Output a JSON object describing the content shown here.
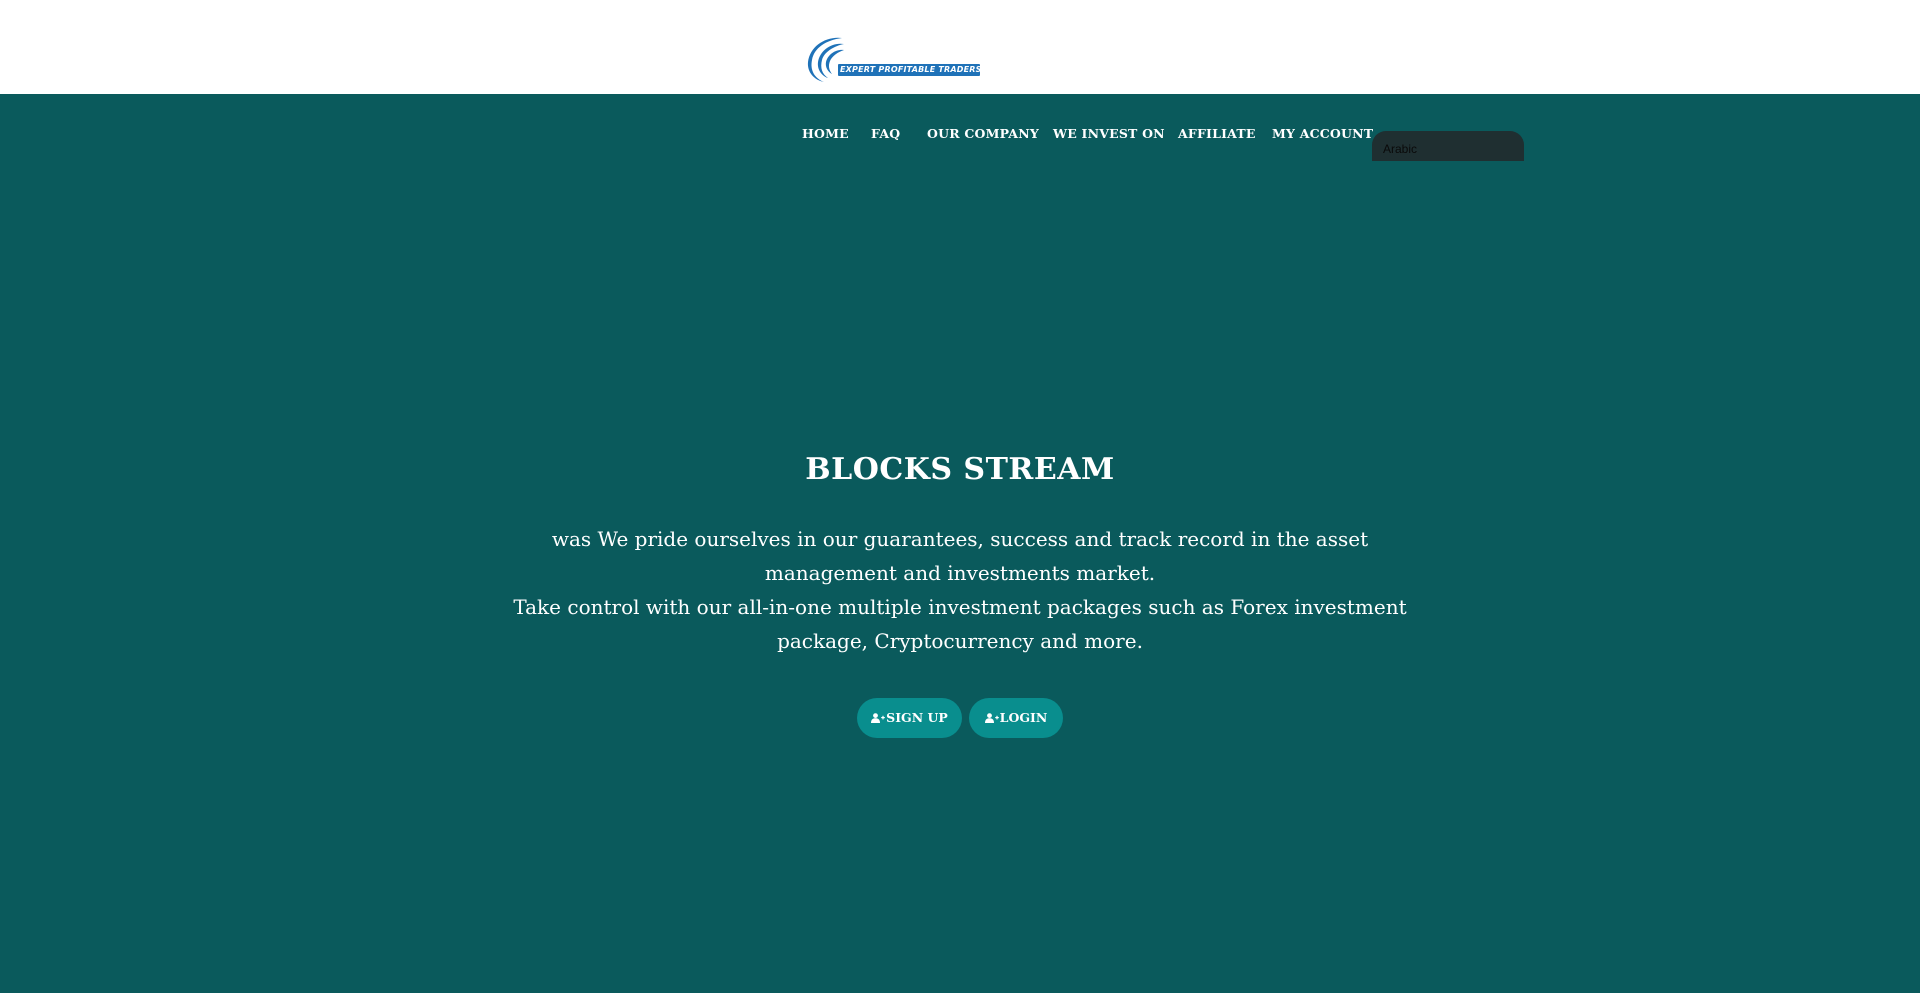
{
  "header": {
    "logo_text": "EXPERT PROFITABLE TRADERS",
    "brand_color": "#1f72b8"
  },
  "nav": {
    "items": [
      {
        "label": "HOME"
      },
      {
        "label": "FAQ"
      },
      {
        "label": "OUR COMPANY"
      },
      {
        "label": "WE INVEST ON"
      },
      {
        "label": "AFFILIATE"
      },
      {
        "label": "MY ACCOUNT"
      }
    ]
  },
  "language_select": {
    "value": "Arabic"
  },
  "hero": {
    "title": "BLOCKS STREAM",
    "paragraph_1": "was We pride ourselves in our guarantees, success and track record in the asset management and investments market.",
    "paragraph_2": "Take control with our all-in-one multiple investment packages such as Forex investment package, Cryptocurrency and more.",
    "signup_label": "SIGN UP",
    "login_label": "LOGIN",
    "signup_icon": "user-plus-icon",
    "login_icon": "user-plus-icon"
  },
  "colors": {
    "background": "#0a5a5c",
    "button": "#098e8e",
    "header_bg": "#ffffff"
  }
}
